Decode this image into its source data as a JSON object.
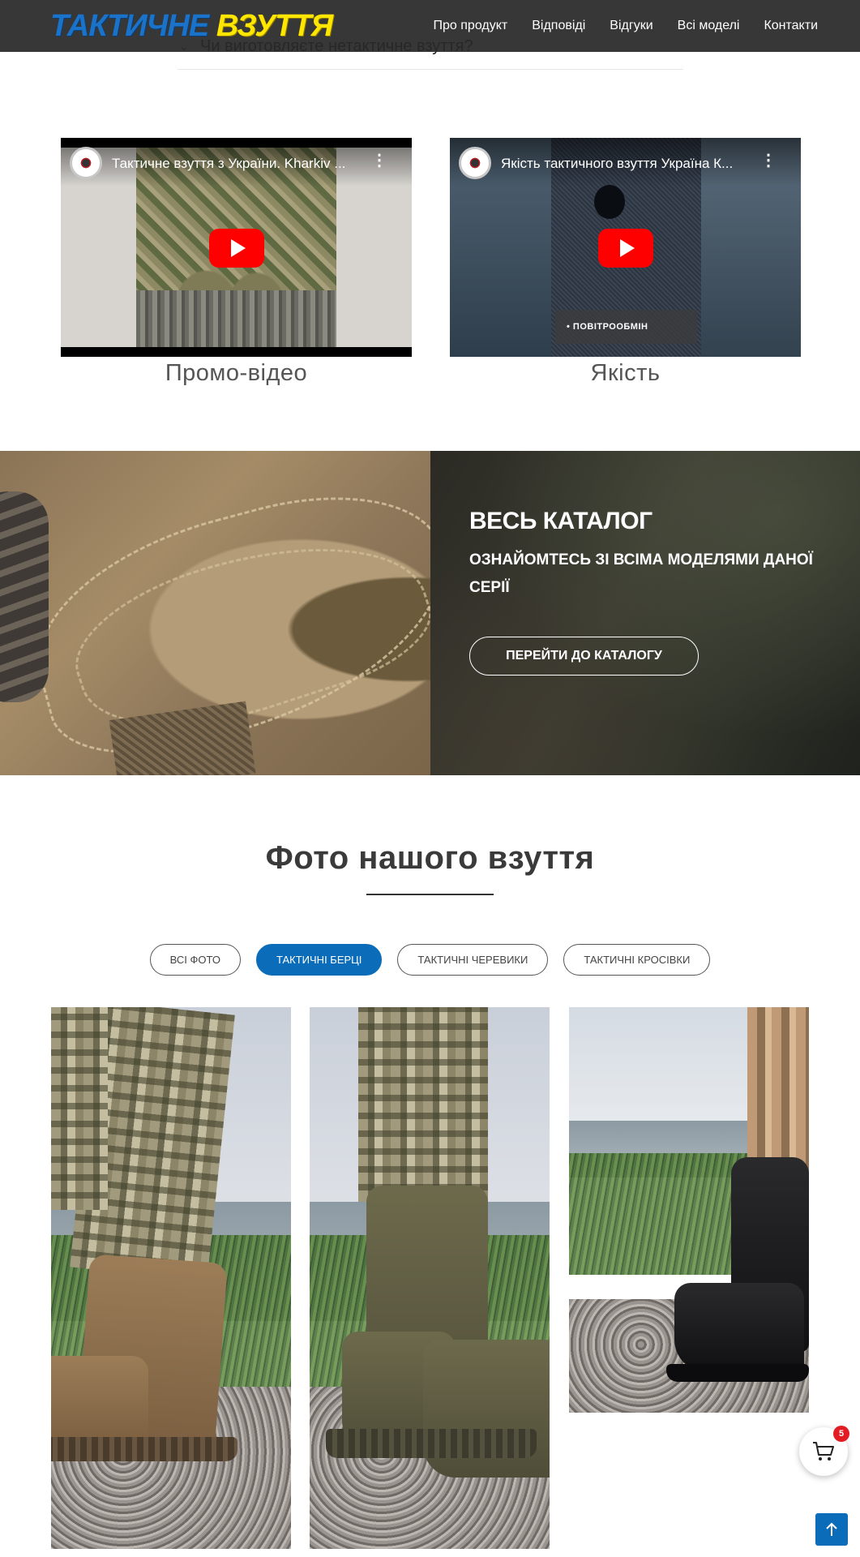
{
  "header": {
    "logo_part1": "ТАКТИЧНЕ",
    "logo_part2": "ВЗУТТЯ",
    "nav": [
      "Про продукт",
      "Відповіді",
      "Відгуки",
      "Всі моделі",
      "Контакти"
    ],
    "colors": {
      "bar": "#282828",
      "logo_blue": "#1b73c9",
      "logo_yellow": "#ffe600"
    }
  },
  "faq": {
    "question": "Чи виготовляєте нетактичне взуття?",
    "icon": "chevron-down-icon"
  },
  "videos": [
    {
      "title": "Тактичне взуття з України. Kharkiv ...",
      "caption": "Промо-відео",
      "play_icon": "youtube-play-icon"
    },
    {
      "title": "Якість тактичного взуття Україна К...",
      "caption": "Якість",
      "badge": "• ПОВІТРООБМІН",
      "play_icon": "youtube-play-icon"
    }
  ],
  "catalog": {
    "title": "ВЕСЬ КАТАЛОГ",
    "subtitle": "ОЗНАЙОМТЕСЬ ЗІ ВСІМА МОДЕЛЯМИ ДАНОЇ СЕРІЇ",
    "button": "ПЕРЕЙТИ ДО КАТАЛОГУ"
  },
  "photos": {
    "title": "Фото нашого взуття",
    "filters": [
      {
        "label": "ВСІ ФОТО",
        "active": false
      },
      {
        "label": "ТАКТИЧНІ БЕРЦІ",
        "active": true
      },
      {
        "label": "ТАКТИЧНІ ЧЕРЕВИКИ",
        "active": false
      },
      {
        "label": "ТАКТИЧНІ КРОСІВКИ",
        "active": false
      }
    ],
    "accent": "#0b6db9"
  },
  "cart": {
    "count": "5",
    "icon": "shopping-cart-icon"
  },
  "scroll_top": {
    "icon": "arrow-up-icon"
  }
}
